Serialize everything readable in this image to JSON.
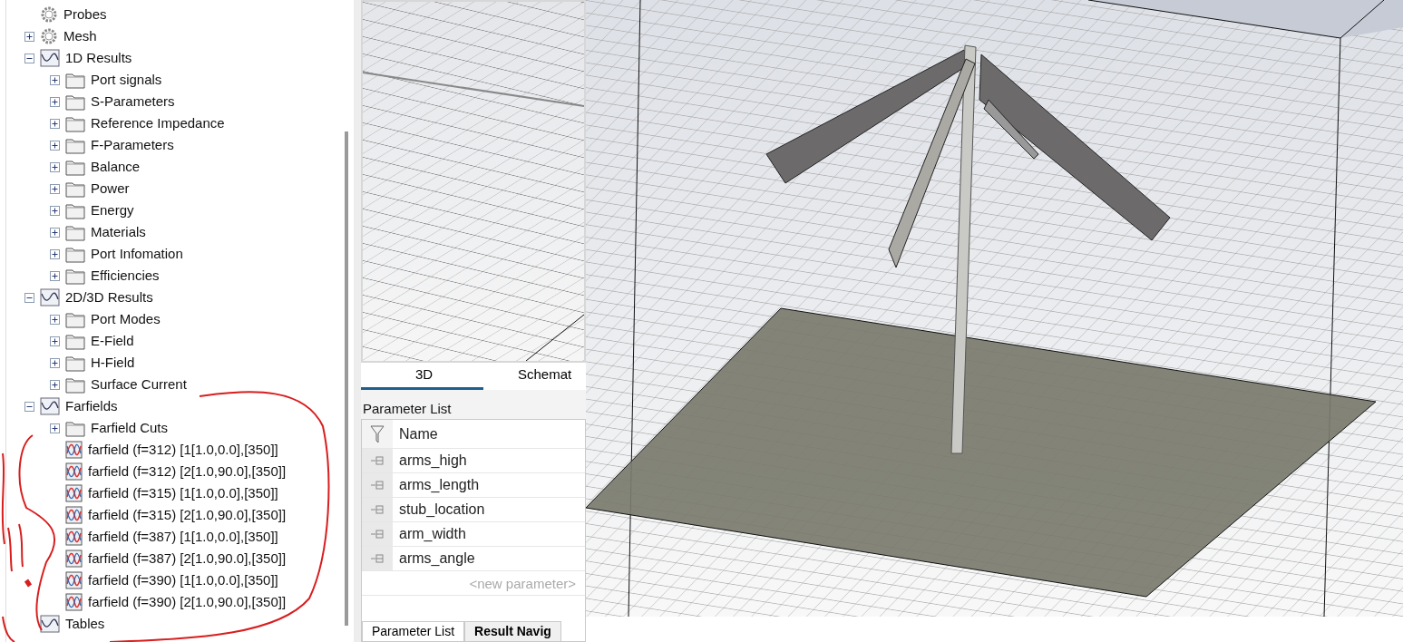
{
  "tree": [
    {
      "label": "Probes",
      "kind": "gear"
    },
    {
      "label": "Mesh",
      "kind": "gear",
      "expanded": false
    },
    {
      "label": "1D Results",
      "kind": "results",
      "expanded": true,
      "children": [
        {
          "label": "Port signals",
          "kind": "folder",
          "expanded": false
        },
        {
          "label": "S-Parameters",
          "kind": "folder",
          "expanded": false
        },
        {
          "label": "Reference Impedance",
          "kind": "folder",
          "expanded": false
        },
        {
          "label": "F-Parameters",
          "kind": "folder",
          "expanded": false
        },
        {
          "label": "Balance",
          "kind": "folder",
          "expanded": false
        },
        {
          "label": "Power",
          "kind": "folder",
          "expanded": false
        },
        {
          "label": "Energy",
          "kind": "folder",
          "expanded": false
        },
        {
          "label": "Materials",
          "kind": "folder",
          "expanded": false
        },
        {
          "label": "Port Infomation",
          "kind": "folder",
          "expanded": false
        },
        {
          "label": "Efficiencies",
          "kind": "folder",
          "expanded": false
        }
      ]
    },
    {
      "label": "2D/3D Results",
      "kind": "results",
      "expanded": true,
      "children": [
        {
          "label": "Port Modes",
          "kind": "folder",
          "expanded": false
        },
        {
          "label": "E-Field",
          "kind": "folder",
          "expanded": false
        },
        {
          "label": "H-Field",
          "kind": "folder",
          "expanded": false
        },
        {
          "label": "Surface Current",
          "kind": "folder",
          "expanded": false
        }
      ]
    },
    {
      "label": "Farfields",
      "kind": "results",
      "expanded": true,
      "children": [
        {
          "label": "Farfield Cuts",
          "kind": "folder",
          "expanded": false
        },
        {
          "label": "farfield (f=312) [1[1.0,0.0],[350]]",
          "kind": "farfield"
        },
        {
          "label": "farfield (f=312) [2[1.0,90.0],[350]]",
          "kind": "farfield"
        },
        {
          "label": "farfield (f=315) [1[1.0,0.0],[350]]",
          "kind": "farfield"
        },
        {
          "label": "farfield (f=315) [2[1.0,90.0],[350]]",
          "kind": "farfield"
        },
        {
          "label": "farfield (f=387) [1[1.0,0.0],[350]]",
          "kind": "farfield"
        },
        {
          "label": "farfield (f=387) [2[1.0,90.0],[350]]",
          "kind": "farfield"
        },
        {
          "label": "farfield (f=390) [1[1.0,0.0],[350]]",
          "kind": "farfield"
        },
        {
          "label": "farfield (f=390) [2[1.0,90.0],[350]]",
          "kind": "farfield"
        }
      ]
    },
    {
      "label": "Tables",
      "kind": "results"
    }
  ],
  "view_tabs": [
    {
      "label": "3D",
      "selected": true
    },
    {
      "label": "Schemat",
      "selected": false
    }
  ],
  "parameter_list": {
    "title": "Parameter List",
    "column": "Name",
    "rows": [
      "arms_high",
      "arms_length",
      "stub_location",
      "arm_width",
      "arms_angle"
    ],
    "placeholder": "<new parameter>"
  },
  "bottom_tabs": [
    {
      "label": "Parameter List",
      "selected": true
    },
    {
      "label": "Result Navig",
      "selected": false
    }
  ]
}
